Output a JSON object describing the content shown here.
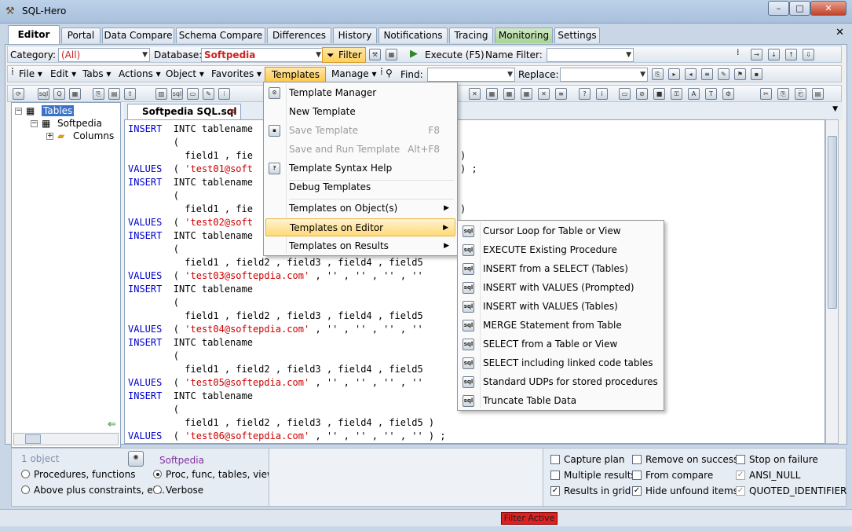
{
  "window": {
    "title": "SQL-Hero",
    "minimize": "–",
    "maximize": "□",
    "close": "✕"
  },
  "tabs": [
    "Editor",
    "Portal",
    "Data Compare",
    "Schema Compare",
    "Differences",
    "History",
    "Notifications",
    "Tracing",
    "Monitoring",
    "Settings"
  ],
  "toolbar1": {
    "category_label": "Category:",
    "category_value": "(All)",
    "database_label": "Database:",
    "database_value": "Softpedia",
    "filter_label": "Filter",
    "execute_label": "Execute (F5)",
    "namefilter_label": "Name Filter:",
    "namefilter_value": ""
  },
  "toolbar2": {
    "file": "File",
    "edit": "Edit",
    "tabs": "Tabs",
    "actions": "Actions",
    "object": "Object",
    "favorites": "Favorites",
    "templates": "Templates",
    "manage": "Manage",
    "find_label": "Find:",
    "find_value": "",
    "replace_label": "Replace:",
    "replace_value": ""
  },
  "tree": {
    "root": "Tables",
    "db": "Softpedia",
    "columns": "Columns"
  },
  "editor": {
    "tab_title": "Softpedia SQL.sql",
    "lines": [
      {
        "kw": "INSERT",
        "rest": "  INTC tablename"
      },
      {
        "kw": "",
        "rest": "        ("
      },
      {
        "kw": "",
        "rest": "          field1 , fie"
      },
      {
        "kw": "VALUES",
        "rest": "  ( ",
        "str": "'test01@soft"
      },
      {
        "kw": "INSERT",
        "rest": "  INTC tablename"
      },
      {
        "kw": "",
        "rest": "        ("
      },
      {
        "kw": "",
        "rest": "          field1 , fie"
      },
      {
        "kw": "VALUES",
        "rest": "  ( ",
        "str": "'test02@soft"
      },
      {
        "kw": "INSERT",
        "rest": "  INTC tablename"
      },
      {
        "kw": "",
        "rest": "        ("
      },
      {
        "kw": "",
        "rest": "          field1 , field2 , field3 , field4 , field5"
      },
      {
        "kw": "VALUES",
        "rest": "  ( ",
        "str": "'test03@softepdia.com'",
        "tail": " , '' , '' , '' , ''"
      },
      {
        "kw": "INSERT",
        "rest": "  INTC tablename"
      },
      {
        "kw": "",
        "rest": "        ("
      },
      {
        "kw": "",
        "rest": "          field1 , field2 , field3 , field4 , field5"
      },
      {
        "kw": "VALUES",
        "rest": "  ( ",
        "str": "'test04@softepdia.com'",
        "tail": " , '' , '' , '' , ''"
      },
      {
        "kw": "INSERT",
        "rest": "  INTC tablename"
      },
      {
        "kw": "",
        "rest": "        ("
      },
      {
        "kw": "",
        "rest": "          field1 , field2 , field3 , field4 , field5"
      },
      {
        "kw": "VALUES",
        "rest": "  ( ",
        "str": "'test05@softepdia.com'",
        "tail": " , '' , '' , '' , ''"
      },
      {
        "kw": "INSERT",
        "rest": "  INTC tablename"
      },
      {
        "kw": "",
        "rest": "        ("
      },
      {
        "kw": "",
        "rest": "          field1 , field2 , field3 , field4 , field5 )"
      },
      {
        "kw": "VALUES",
        "rest": "  ( ",
        "str": "'test06@softepdia.com'",
        "tail": " , '' , '' , '' , '' ) ;"
      }
    ],
    "fragments": {
      "r3": ")",
      "r4": ") ;",
      "r7": ")",
      "r8": ")"
    }
  },
  "templates_menu": [
    {
      "label": "Template Manager",
      "shortcut": "",
      "disabled": false,
      "sub": false
    },
    {
      "label": "New Template",
      "shortcut": "",
      "disabled": false,
      "sub": false
    },
    {
      "label": "Save Template",
      "shortcut": "F8",
      "disabled": true,
      "sub": false
    },
    {
      "label": "Save and Run Template",
      "shortcut": "Alt+F8",
      "disabled": true,
      "sub": false
    },
    {
      "label": "Template Syntax Help",
      "shortcut": "",
      "disabled": false,
      "sub": false
    },
    {
      "label": "Debug Templates",
      "shortcut": "",
      "disabled": false,
      "sub": false
    },
    {
      "label": "Templates on Object(s)",
      "shortcut": "",
      "disabled": false,
      "sub": true
    },
    {
      "label": "Templates on Editor",
      "shortcut": "",
      "disabled": false,
      "sub": true
    },
    {
      "label": "Templates on Results",
      "shortcut": "",
      "disabled": false,
      "sub": true
    }
  ],
  "editor_submenu": [
    "Cursor Loop for Table or View",
    "EXECUTE Existing Procedure",
    "INSERT from a SELECT (Tables)",
    "INSERT with VALUES (Prompted)",
    "INSERT with VALUES (Tables)",
    "MERGE Statement from Table",
    "SELECT from a Table or View",
    "SELECT including linked code tables",
    "Standard UDPs for stored procedures",
    "Truncate Table Data"
  ],
  "bottom": {
    "object_count": "1 object",
    "db_name": "Softpedia",
    "radios": [
      "Procedures, functions",
      "Proc, func, tables, views",
      "Above plus constraints, etc.",
      "Verbose"
    ],
    "checks": [
      {
        "label": "Capture plan",
        "checked": false
      },
      {
        "label": "Remove on success",
        "checked": false
      },
      {
        "label": "Stop on failure",
        "checked": false
      },
      {
        "label": "Multiple results",
        "checked": false
      },
      {
        "label": "From compare",
        "checked": false
      },
      {
        "label": "ANSI_NULL",
        "checked": true
      },
      {
        "label": "Results in grid",
        "checked": true
      },
      {
        "label": "Hide unfound items",
        "checked": true
      },
      {
        "label": "QUOTED_IDENTIFIER",
        "checked": true
      }
    ]
  },
  "status": {
    "filter_active": "Filter Active"
  },
  "colors": {
    "keyword": "#0000cc",
    "string": "#cc0000",
    "highlight": "#ffd97a",
    "accent": "#e02020"
  }
}
